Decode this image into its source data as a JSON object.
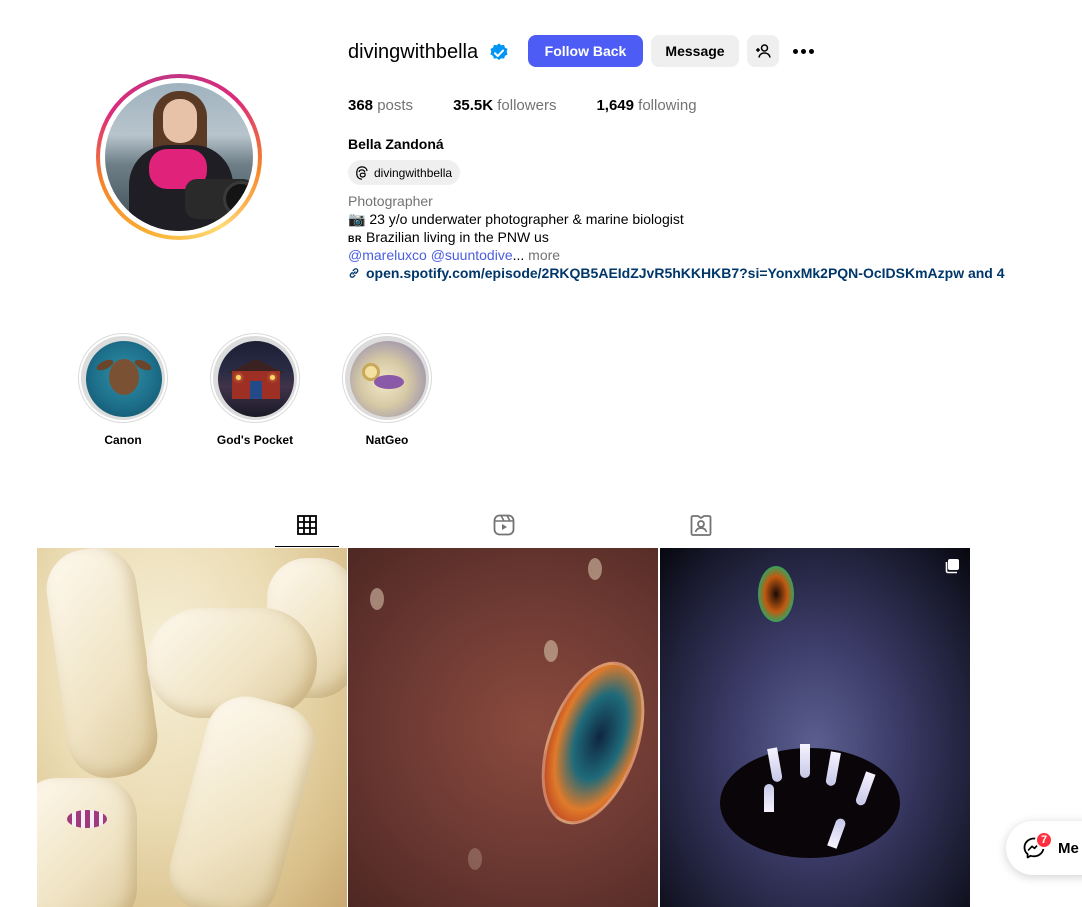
{
  "profile": {
    "username": "divingwithbella",
    "full_name": "Bella Zandoná",
    "threads_handle": "divingwithbella",
    "category": "Photographer",
    "bio_line1_emoji": "📷",
    "bio_line1_text": "23 y/o underwater photographer & marine biologist",
    "bio_line2_flag": "BR",
    "bio_line2_text": "Brazilian living in the PNW us",
    "bio_mention1": "@mareluxco",
    "bio_mention2": "@suuntodive",
    "bio_ellipsis": "...",
    "bio_more": " more",
    "link": "open.spotify.com/episode/2RKQB5AEIdZJvR5hKKHKB7?si=YonxMk2PQN-OcIDSKmAzpw and 4"
  },
  "actions": {
    "follow_back": "Follow Back",
    "message": "Message"
  },
  "stats": {
    "posts_count": "368",
    "posts_label": " posts",
    "followers_count": "35.5K",
    "followers_label": " followers",
    "following_count": "1,649",
    "following_label": " following"
  },
  "highlights": [
    {
      "label": "Canon"
    },
    {
      "label": "God's Pocket"
    },
    {
      "label": "NatGeo"
    }
  ],
  "tabs": {
    "active": "posts",
    "items": [
      "posts-grid-icon",
      "reels-icon",
      "tagged-icon"
    ]
  },
  "messages_widget": {
    "badge_count": "7",
    "label": "Me"
  },
  "colors": {
    "follow_button": "#4c5cf5",
    "verified": "#0095f6",
    "mention": "#4a5de0",
    "link": "#00376b",
    "badge": "#ff3040"
  }
}
